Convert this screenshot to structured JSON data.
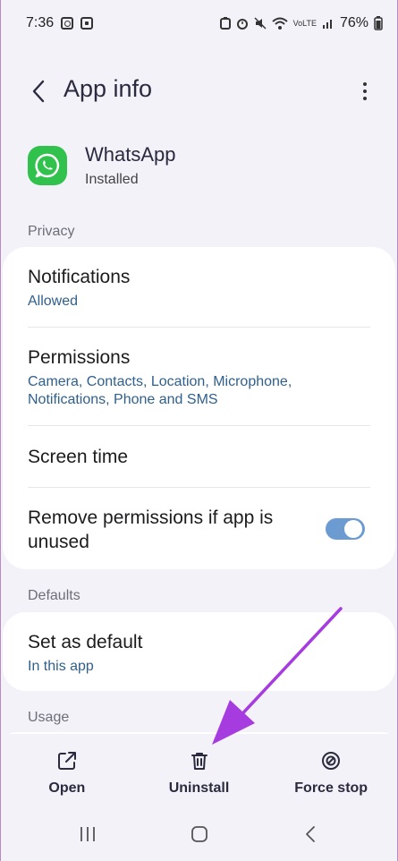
{
  "status_bar": {
    "time": "7:36",
    "volte": "VoLTE",
    "battery": "76%"
  },
  "app_bar": {
    "title": "App info"
  },
  "app": {
    "name": "WhatsApp",
    "status": "Installed"
  },
  "sections": {
    "privacy_label": "Privacy",
    "defaults_label": "Defaults",
    "usage_label": "Usage"
  },
  "privacy_items": {
    "notifications_title": "Notifications",
    "notifications_sub": "Allowed",
    "permissions_title": "Permissions",
    "permissions_sub": "Camera, Contacts, Location, Microphone, Notifications, Phone and SMS",
    "screen_time_title": "Screen time",
    "remove_permissions_title": "Remove permissions if app is unused",
    "remove_permissions_enabled": true
  },
  "defaults_items": {
    "set_default_title": "Set as default",
    "set_default_sub": "In this app"
  },
  "bottom_actions": {
    "open_label": "Open",
    "uninstall_label": "Uninstall",
    "force_stop_label": "Force stop"
  },
  "colors": {
    "accent_link": "#2f5f8c",
    "toggle_on": "#6c9bd2",
    "whatsapp_green": "#31c24d",
    "annotation_arrow": "#a63be0"
  },
  "icons": [
    "back-arrow-icon",
    "more-vert-icon",
    "whatsapp-icon",
    "open-external-icon",
    "trash-icon",
    "block-icon",
    "recents-icon",
    "home-icon",
    "back-nav-icon"
  ]
}
